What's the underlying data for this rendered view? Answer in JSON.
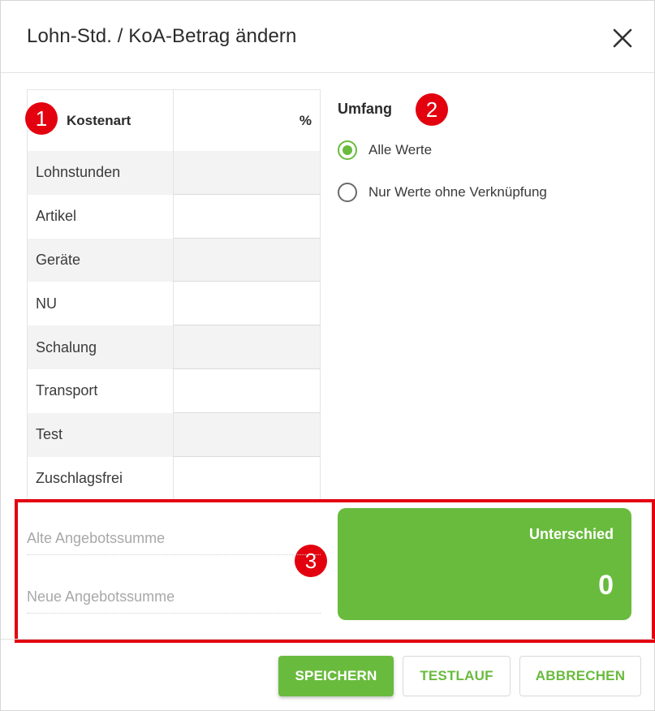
{
  "dialog": {
    "title": "Lohn-Std. / KoA-Betrag ändern",
    "close_icon": "close-icon"
  },
  "table": {
    "headers": {
      "kostenart": "Kostenart",
      "percent": "%"
    },
    "rows": [
      {
        "label": "Lohnstunden",
        "value": ""
      },
      {
        "label": "Artikel",
        "value": ""
      },
      {
        "label": "Geräte",
        "value": ""
      },
      {
        "label": "NU",
        "value": ""
      },
      {
        "label": "Schalung",
        "value": ""
      },
      {
        "label": "Transport",
        "value": ""
      },
      {
        "label": "Test",
        "value": ""
      },
      {
        "label": "Zuschlagsfrei",
        "value": ""
      }
    ]
  },
  "umfang": {
    "label": "Umfang",
    "options": [
      {
        "label": "Alle Werte",
        "selected": true
      },
      {
        "label": "Nur Werte ohne Verknüpfung",
        "selected": false
      }
    ]
  },
  "sums": {
    "alte_label": "Alte Angebotssumme",
    "neue_label": "Neue Angebotssumme"
  },
  "difference": {
    "label": "Unterschied",
    "value": "0"
  },
  "buttons": {
    "save": "SPEICHERN",
    "test": "TESTLAUF",
    "cancel": "ABBRECHEN"
  },
  "badges": [
    "1",
    "2",
    "3"
  ],
  "colors": {
    "accent": "#69bb3d",
    "badge": "#e3000f",
    "highlight": "#e3000f"
  }
}
